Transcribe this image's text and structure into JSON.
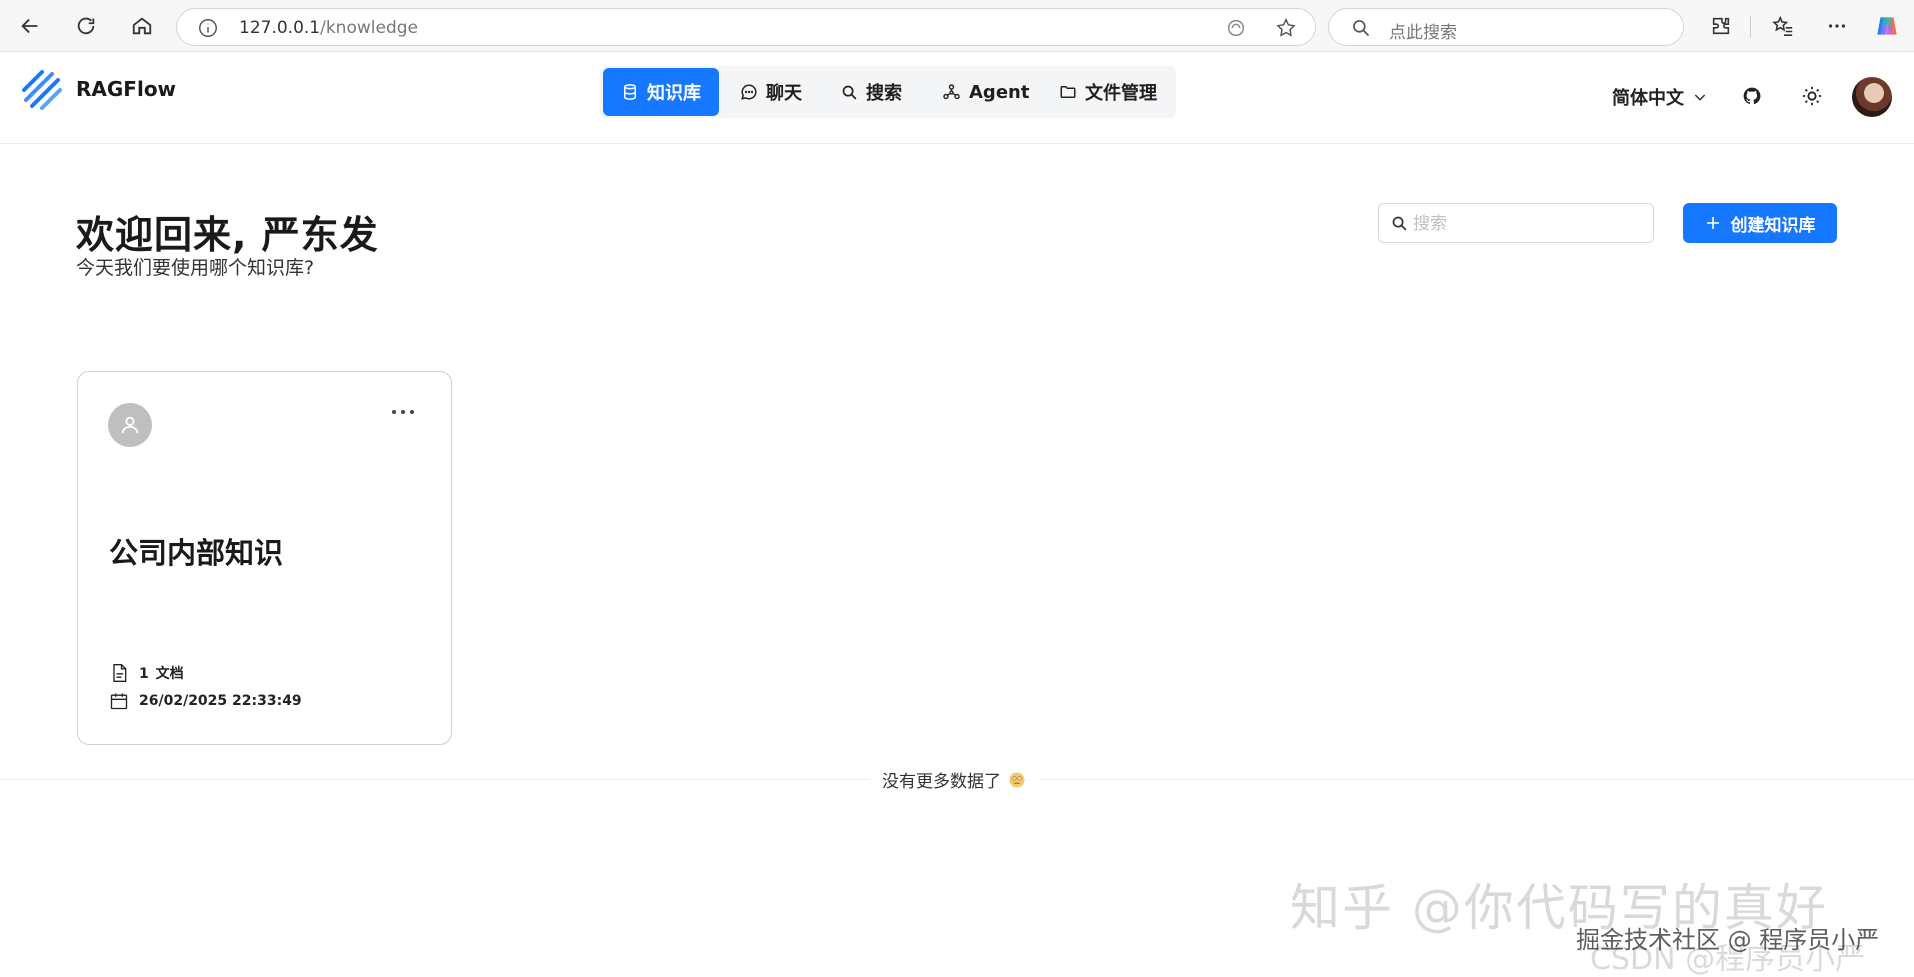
{
  "browser": {
    "url_host": "127.0.0.1",
    "url_path": "/knowledge",
    "search_placeholder": "点此搜索"
  },
  "header": {
    "brand": "RAGFlow",
    "nav": [
      {
        "label": "知识库",
        "icon": "database-icon",
        "active": true
      },
      {
        "label": "聊天",
        "icon": "chat-icon",
        "active": false
      },
      {
        "label": "搜索",
        "icon": "search-icon",
        "active": false
      },
      {
        "label": "Agent",
        "icon": "agent-graph-icon",
        "active": false
      },
      {
        "label": "文件管理",
        "icon": "folder-icon",
        "active": false
      }
    ],
    "language": "简体中文"
  },
  "main": {
    "welcome": "欢迎回来, 严东发",
    "subtitle": "今天我们要使用哪个知识库?",
    "search_placeholder": "搜索",
    "create_label": "创建知识库"
  },
  "cards": [
    {
      "title": "公司内部知识",
      "doc_count": "1",
      "doc_unit": "文档",
      "updated": "26/02/2025 22:33:49"
    }
  ],
  "end_of_list": "没有更多数据了",
  "watermarks": {
    "zhihu": "知乎 @你代码写的真好",
    "juejin": "掘金技术社区 @ 程序员小严",
    "csdn": "CSDN @程序员小严"
  },
  "colors": {
    "accent": "#1677ff",
    "card_border": "#d0d0d0"
  }
}
